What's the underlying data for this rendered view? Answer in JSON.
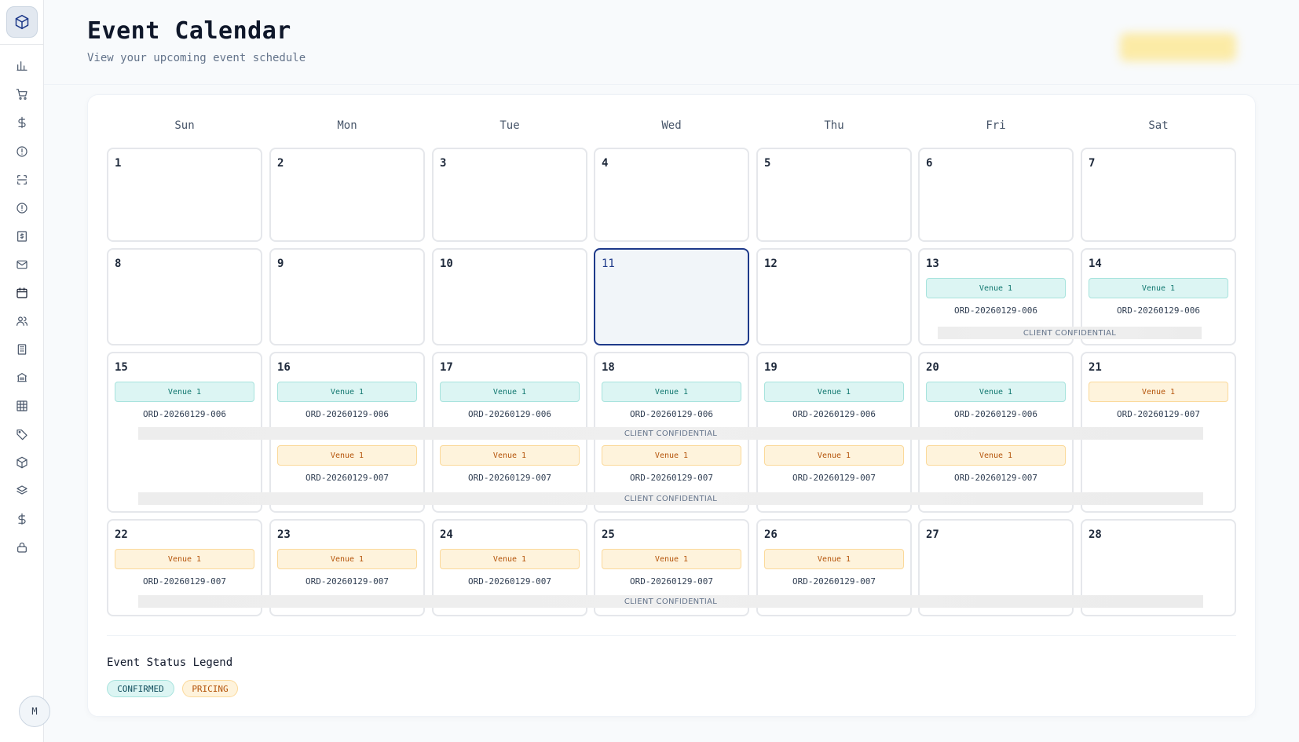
{
  "app": {
    "title": "Event Calendar",
    "subtitle": "View your upcoming event schedule"
  },
  "sidebar": {
    "avatar_initial": "M",
    "items": [
      {
        "icon": "bar-chart-icon"
      },
      {
        "icon": "cart-icon"
      },
      {
        "icon": "dollar-icon"
      },
      {
        "icon": "alert-circle-icon"
      },
      {
        "icon": "scan-icon"
      },
      {
        "icon": "alert-circle-icon"
      },
      {
        "icon": "receipt-icon"
      },
      {
        "icon": "mail-icon"
      },
      {
        "icon": "calendar-icon",
        "active": true
      },
      {
        "icon": "users-icon"
      },
      {
        "icon": "building-icon"
      },
      {
        "icon": "bank-icon"
      },
      {
        "icon": "grid-icon"
      },
      {
        "icon": "tag-icon"
      },
      {
        "icon": "package-icon"
      },
      {
        "icon": "layers-icon"
      },
      {
        "icon": "dollar-icon"
      },
      {
        "icon": "lock-icon"
      }
    ]
  },
  "calendar": {
    "weekdays": [
      "Sun",
      "Mon",
      "Tue",
      "Wed",
      "Thu",
      "Fri",
      "Sat"
    ],
    "today": 11,
    "confidential_label": "CLIENT CONFIDENTIAL",
    "weeks": [
      [
        {
          "day": "1",
          "events": []
        },
        {
          "day": "2",
          "events": []
        },
        {
          "day": "3",
          "events": []
        },
        {
          "day": "4",
          "events": []
        },
        {
          "day": "5",
          "events": []
        },
        {
          "day": "6",
          "events": []
        },
        {
          "day": "7",
          "events": []
        }
      ],
      [
        {
          "day": "8",
          "events": []
        },
        {
          "day": "9",
          "events": []
        },
        {
          "day": "10",
          "events": []
        },
        {
          "day": "11",
          "events": []
        },
        {
          "day": "12",
          "events": []
        },
        {
          "day": "13",
          "events": [
            {
              "venue": "Venue 1",
              "order": "ORD-20260129-006",
              "status": "confirmed"
            }
          ]
        },
        {
          "day": "14",
          "events": [
            {
              "venue": "Venue 1",
              "order": "ORD-20260129-006",
              "status": "confirmed"
            }
          ]
        }
      ],
      [
        {
          "day": "15",
          "events": [
            {
              "venue": "Venue 1",
              "order": "ORD-20260129-006",
              "status": "confirmed"
            }
          ]
        },
        {
          "day": "16",
          "events": [
            {
              "venue": "Venue 1",
              "order": "ORD-20260129-006",
              "status": "confirmed"
            },
            {
              "venue": "Venue 1",
              "order": "ORD-20260129-007",
              "status": "pricing"
            }
          ]
        },
        {
          "day": "17",
          "events": [
            {
              "venue": "Venue 1",
              "order": "ORD-20260129-006",
              "status": "confirmed"
            },
            {
              "venue": "Venue 1",
              "order": "ORD-20260129-007",
              "status": "pricing"
            }
          ]
        },
        {
          "day": "18",
          "events": [
            {
              "venue": "Venue 1",
              "order": "ORD-20260129-006",
              "status": "confirmed"
            },
            {
              "venue": "Venue 1",
              "order": "ORD-20260129-007",
              "status": "pricing"
            }
          ]
        },
        {
          "day": "19",
          "events": [
            {
              "venue": "Venue 1",
              "order": "ORD-20260129-006",
              "status": "confirmed"
            },
            {
              "venue": "Venue 1",
              "order": "ORD-20260129-007",
              "status": "pricing"
            }
          ]
        },
        {
          "day": "20",
          "events": [
            {
              "venue": "Venue 1",
              "order": "ORD-20260129-006",
              "status": "confirmed"
            },
            {
              "venue": "Venue 1",
              "order": "ORD-20260129-007",
              "status": "pricing"
            }
          ]
        },
        {
          "day": "21",
          "events": [
            {
              "venue": "Venue 1",
              "order": "ORD-20260129-007",
              "status": "pricing"
            }
          ]
        }
      ],
      [
        {
          "day": "22",
          "events": [
            {
              "venue": "Venue 1",
              "order": "ORD-20260129-007",
              "status": "pricing"
            }
          ]
        },
        {
          "day": "23",
          "events": [
            {
              "venue": "Venue 1",
              "order": "ORD-20260129-007",
              "status": "pricing"
            }
          ]
        },
        {
          "day": "24",
          "events": [
            {
              "venue": "Venue 1",
              "order": "ORD-20260129-007",
              "status": "pricing"
            }
          ]
        },
        {
          "day": "25",
          "events": [
            {
              "venue": "Venue 1",
              "order": "ORD-20260129-007",
              "status": "pricing"
            }
          ]
        },
        {
          "day": "26",
          "events": [
            {
              "venue": "Venue 1",
              "order": "ORD-20260129-007",
              "status": "pricing"
            }
          ]
        },
        {
          "day": "27",
          "events": []
        },
        {
          "day": "28",
          "events": []
        }
      ]
    ]
  },
  "legend": {
    "title": "Event Status Legend",
    "confirmed": "CONFIRMED",
    "pricing": "PRICING"
  },
  "colors": {
    "confirmed": "#0f766e",
    "pricing": "#b45309",
    "today_border": "#1e3a8a"
  }
}
